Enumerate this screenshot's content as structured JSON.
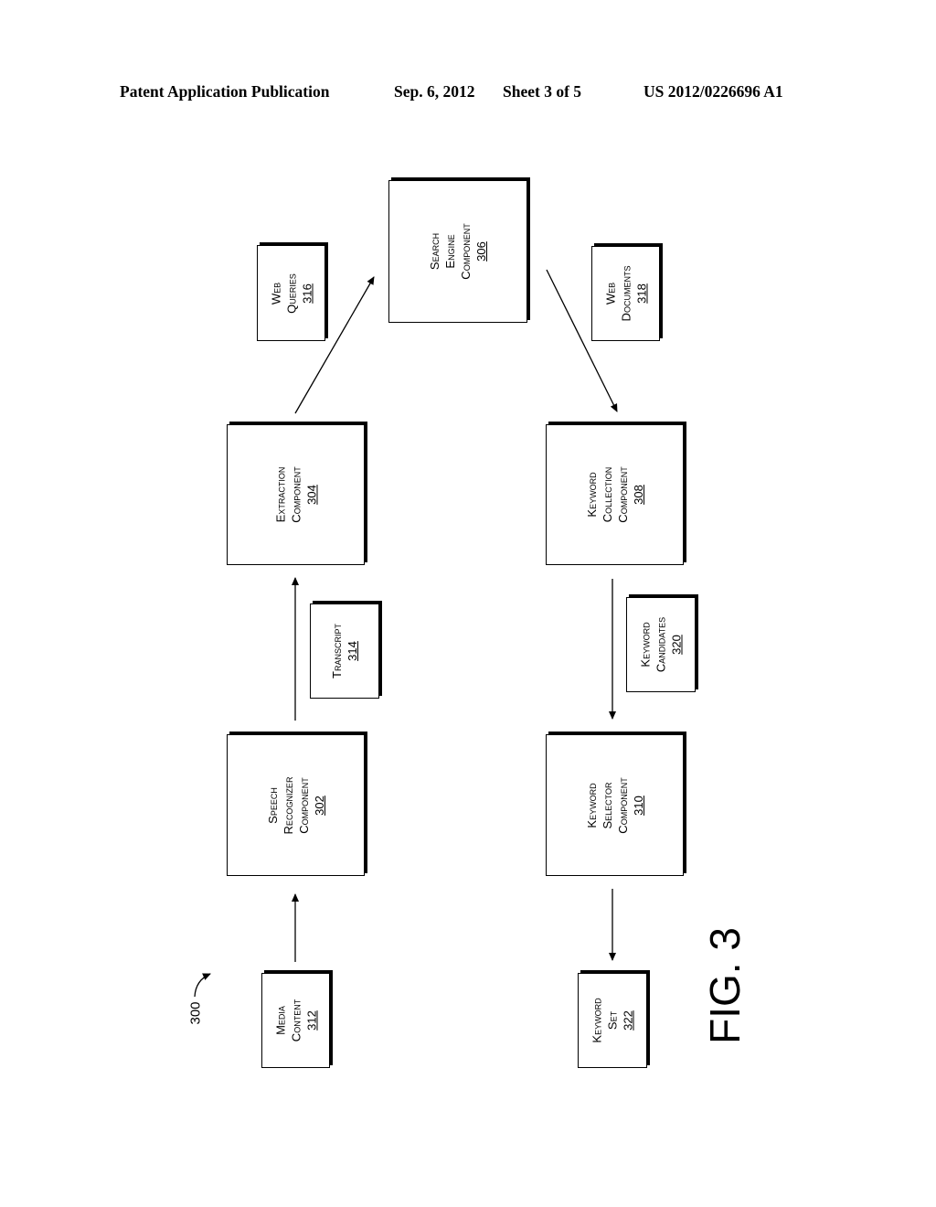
{
  "header": {
    "publication": "Patent Application Publication",
    "date": "Sep. 6, 2012",
    "sheet": "Sheet 3 of 5",
    "patent_number": "US 2012/0226696 A1"
  },
  "diagram": {
    "reference": "300",
    "figure_label": "FIG. 3",
    "nodes": {
      "search_engine": {
        "lines": [
          "Search",
          "Engine",
          "Component"
        ],
        "number": "306"
      },
      "web_queries": {
        "lines": [
          "Web",
          "Queries"
        ],
        "number": "316"
      },
      "web_documents": {
        "lines": [
          "Web",
          "Documents"
        ],
        "number": "318"
      },
      "extraction": {
        "lines": [
          "Extraction",
          "Component"
        ],
        "number": "304"
      },
      "keyword_collection": {
        "lines": [
          "Keyword",
          "Collection",
          "Component"
        ],
        "number": "308"
      },
      "transcript": {
        "lines": [
          "Transcript"
        ],
        "number": "314"
      },
      "keyword_candidates": {
        "lines": [
          "Keyword",
          "Candidates"
        ],
        "number": "320"
      },
      "speech_recognizer": {
        "lines": [
          "Speech",
          "Recognizer",
          "Component"
        ],
        "number": "302"
      },
      "keyword_selector": {
        "lines": [
          "Keyword",
          "Selector",
          "Component"
        ],
        "number": "310"
      },
      "media_content": {
        "lines": [
          "Media",
          "Content"
        ],
        "number": "312"
      },
      "keyword_set": {
        "lines": [
          "Keyword",
          "Set"
        ],
        "number": "322"
      }
    },
    "edges": [
      {
        "from": "media_content",
        "to": "speech_recognizer"
      },
      {
        "from": "speech_recognizer",
        "to": "extraction",
        "label": "transcript"
      },
      {
        "from": "extraction",
        "to": "search_engine",
        "label": "web_queries"
      },
      {
        "from": "search_engine",
        "to": "keyword_collection",
        "label": "web_documents"
      },
      {
        "from": "keyword_collection",
        "to": "keyword_selector",
        "label": "keyword_candidates"
      },
      {
        "from": "keyword_selector",
        "to": "keyword_set"
      }
    ]
  }
}
